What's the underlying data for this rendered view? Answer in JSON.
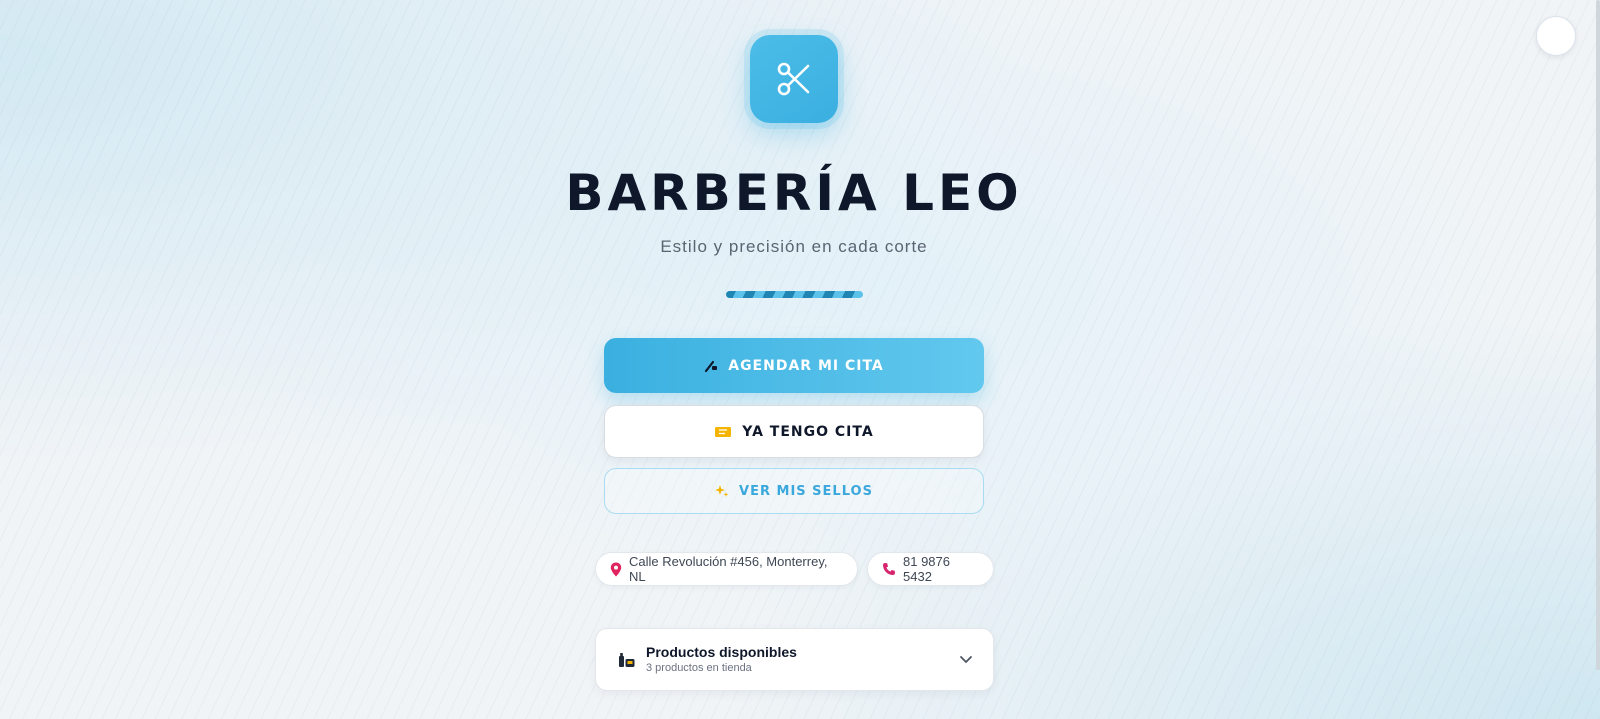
{
  "brand": {
    "title": "BARBERÍA LEO",
    "tagline": "Estilo y precisión en cada corte",
    "logo_icon": "scissors-icon",
    "accent_color": "#3ab0e0"
  },
  "theme_toggle": {
    "icon": "moon-icon"
  },
  "actions": {
    "book": {
      "label": "AGENDAR MI CITA",
      "icon": "razor-icon"
    },
    "have_appointment": {
      "label": "YA TENGO CITA",
      "icon": "ticket-icon"
    },
    "stamps": {
      "label": "VER MIS SELLOS",
      "icon": "sparkles-icon"
    }
  },
  "contact": {
    "address": {
      "text": "Calle Revolución #456, Monterrey, NL",
      "icon": "pin-icon"
    },
    "phone": {
      "text": "81 9876 5432",
      "icon": "phone-icon"
    }
  },
  "products": {
    "title": "Productos disponibles",
    "subtitle": "3 productos en tienda",
    "icon": "products-icon",
    "toggle_icon": "chevron-down-icon"
  }
}
